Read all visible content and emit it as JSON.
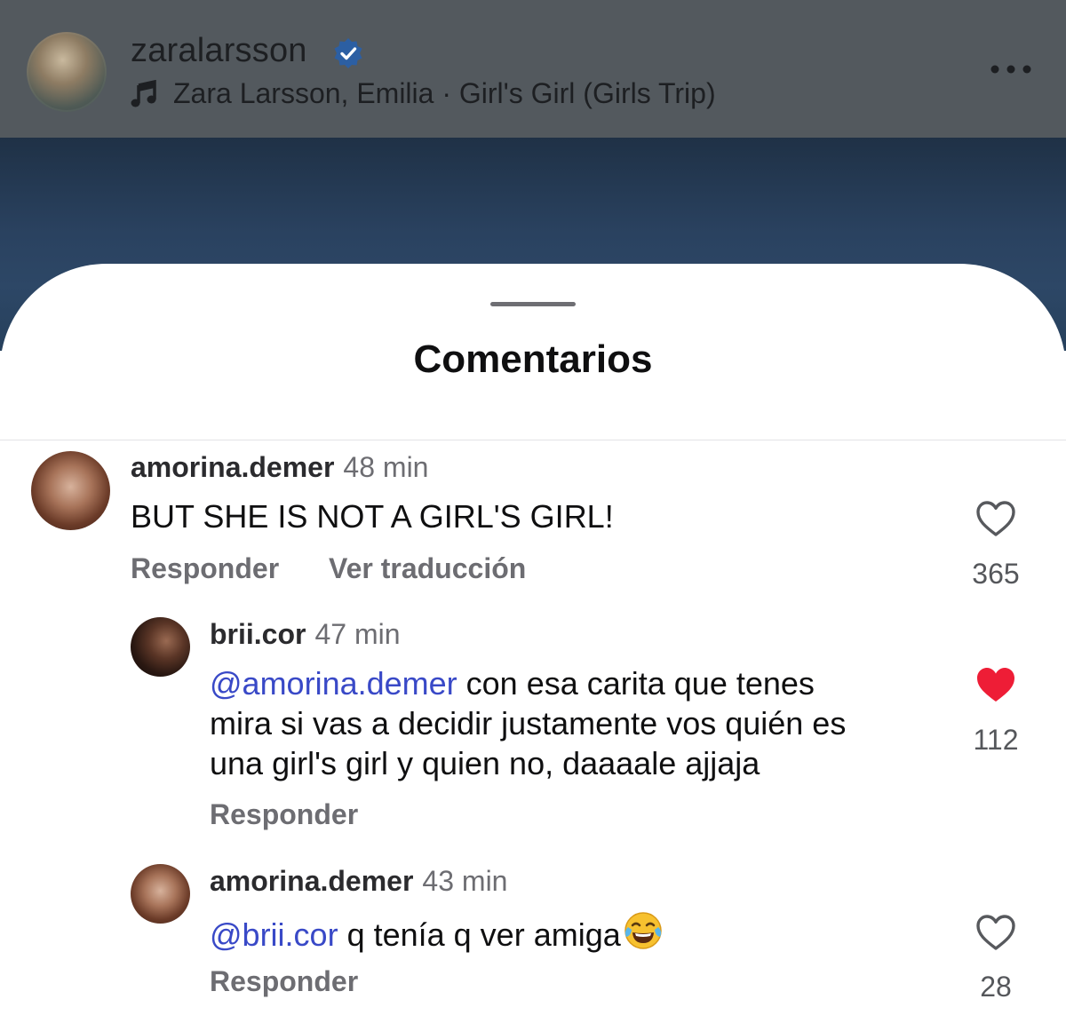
{
  "header": {
    "username": "zaralarsson",
    "song": "Zara Larsson, Emilia · Girl's Girl (Girls Trip)",
    "icons": {
      "verified": "verified-badge-icon",
      "music": "music-note-icon",
      "more": "more-options-icon"
    }
  },
  "sheet": {
    "title": "Comentarios"
  },
  "comments": [
    {
      "username": "amorina.demer",
      "time": "48 min",
      "text": "BUT SHE IS NOT A GIRL'S GIRL!",
      "reply_label": "Responder",
      "translate_label": "Ver traducción",
      "likes": "365",
      "liked": false
    },
    {
      "username": "brii.cor",
      "time": "47 min",
      "mention": "@amorina.demer",
      "text_line1": " con esa carita que tenes",
      "text_line2": "mira si vas a decidir justamente vos quién es",
      "text_line3": "una girl's girl y quien no, daaaale ajjaja",
      "reply_label": "Responder",
      "likes": "112",
      "liked": true
    },
    {
      "username": "amorina.demer",
      "time": "43 min",
      "mention": "@brii.cor",
      "text": " q tenía q ver amiga",
      "emoji": "tears-of-joy-emoji",
      "reply_label": "Responder",
      "likes": "28",
      "liked": false
    }
  ],
  "colors": {
    "mention": "#3949c7",
    "liked_heart": "#ee1d36",
    "header_overlay": "#53595e"
  }
}
